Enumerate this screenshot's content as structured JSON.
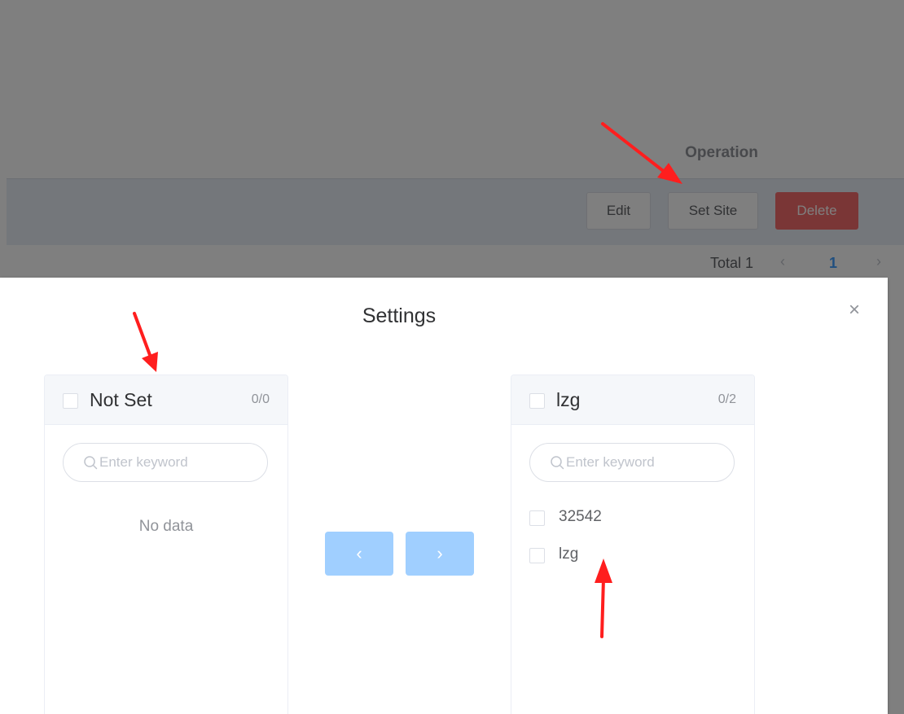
{
  "background": {
    "table_header": {
      "operation_label": "Operation"
    },
    "row_actions": {
      "edit_label": "Edit",
      "set_site_label": "Set Site",
      "delete_label": "Delete"
    },
    "pagination": {
      "total_label": "Total 1",
      "current_page": "1",
      "prev_icon": "‹",
      "next_icon": "›"
    }
  },
  "dialog": {
    "title": "Settings",
    "close_icon": "×",
    "left_panel": {
      "title": "Not Set",
      "count": "0/0",
      "search_placeholder": "Enter keyword",
      "empty_text": "No data",
      "items": []
    },
    "right_panel": {
      "title": "lzg",
      "count": "0/2",
      "search_placeholder": "Enter keyword",
      "items": [
        {
          "label": "32542"
        },
        {
          "label": "lzg"
        }
      ]
    },
    "transfer_buttons": {
      "to_left_icon": "‹",
      "to_right_icon": "›"
    }
  },
  "colors": {
    "primary_light": "#a0cfff",
    "danger": "#f56c6c",
    "annotation_arrow": "#ff1e1e",
    "link": "#409eff"
  }
}
